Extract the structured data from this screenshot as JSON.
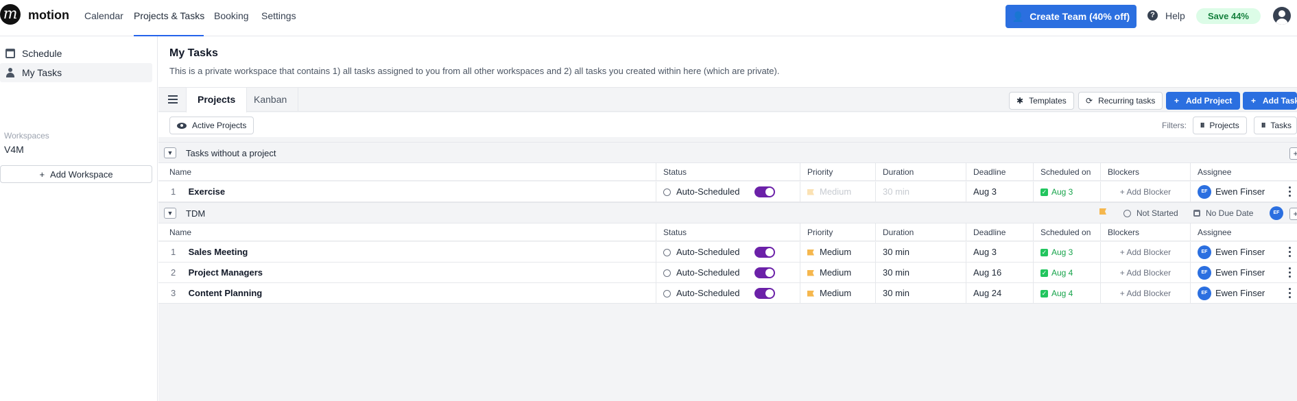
{
  "brand": {
    "name": "motion",
    "logo_glyph": "m"
  },
  "nav": {
    "calendar": "Calendar",
    "projects_tasks": "Projects & Tasks",
    "booking": "Booking",
    "settings": "Settings"
  },
  "header": {
    "create_team": "Create Team (40% off)",
    "help": "Help",
    "save_badge": "Save 44%"
  },
  "sidebar": {
    "items": [
      {
        "label": "Schedule",
        "icon": "calendar-icon"
      },
      {
        "label": "My Tasks",
        "icon": "person-icon"
      }
    ],
    "workspaces_label": "Workspaces",
    "workspace_name": "V4M",
    "add_workspace": "Add Workspace"
  },
  "page": {
    "title": "My Tasks",
    "description": "This is a private workspace that contains 1) all tasks assigned to you from all other workspaces and 2) all tasks you created within here (which are private)."
  },
  "tabs": {
    "projects": "Projects",
    "kanban": "Kanban"
  },
  "toolbar": {
    "templates": "Templates",
    "recurring": "Recurring tasks",
    "add_project": "Add Project",
    "add_task": "Add Task"
  },
  "filters": {
    "active_projects": "Active Projects",
    "label": "Filters:",
    "projects": "Projects",
    "tasks": "Tasks"
  },
  "columns": [
    "Name",
    "Status",
    "Priority",
    "Duration",
    "Deadline",
    "Scheduled on",
    "Blockers",
    "Assignee"
  ],
  "groups": [
    {
      "title": "Tasks without a project",
      "rows": [
        {
          "num": "1",
          "name": "Exercise",
          "status": "Auto-Scheduled",
          "priority": "Medium",
          "duration": "30 min",
          "deadline": "Aug 3",
          "scheduled": "Aug 3",
          "blockers": "+ Add Blocker",
          "assignee_initials": "EF",
          "assignee": "Ewen Finser"
        }
      ]
    },
    {
      "title": "TDM",
      "meta": {
        "status": "Not Started",
        "due": "No Due Date",
        "avatar": "EF"
      },
      "rows": [
        {
          "num": "1",
          "name": "Sales Meeting",
          "status": "Auto-Scheduled",
          "priority": "Medium",
          "duration": "30 min",
          "deadline": "Aug 3",
          "scheduled": "Aug 3",
          "blockers": "+ Add Blocker",
          "assignee_initials": "EF",
          "assignee": "Ewen Finser"
        },
        {
          "num": "2",
          "name": "Project Managers",
          "status": "Auto-Scheduled",
          "priority": "Medium",
          "duration": "30 min",
          "deadline": "Aug 16",
          "scheduled": "Aug 4",
          "blockers": "+ Add Blocker",
          "assignee_initials": "EF",
          "assignee": "Ewen Finser"
        },
        {
          "num": "3",
          "name": "Content Planning",
          "status": "Auto-Scheduled",
          "priority": "Medium",
          "duration": "30 min",
          "deadline": "Aug 24",
          "scheduled": "Aug 4",
          "blockers": "+ Add Blocker",
          "assignee_initials": "EF",
          "assignee": "Ewen Finser"
        }
      ]
    }
  ],
  "colors": {
    "accent": "#2b6fe0",
    "toggle": "#6b21a8",
    "priority_flag": "#f5b74e",
    "scheduled_green": "#16a34a",
    "save_badge_bg": "#dcfce7"
  }
}
